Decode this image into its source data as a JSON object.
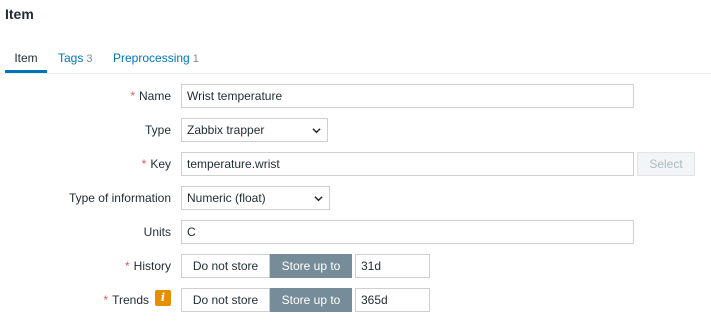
{
  "page": {
    "title": "Item"
  },
  "tabs": [
    {
      "label": "Item",
      "count": ""
    },
    {
      "label": "Tags",
      "count": "3"
    },
    {
      "label": "Preprocessing",
      "count": "1"
    }
  ],
  "form": {
    "name": {
      "label": "Name",
      "value": "Wrist temperature"
    },
    "type": {
      "label": "Type",
      "value": "Zabbix trapper"
    },
    "key": {
      "label": "Key",
      "value": "temperature.wrist",
      "select_label": "Select"
    },
    "type_of_information": {
      "label": "Type of information",
      "value": "Numeric (float)"
    },
    "units": {
      "label": "Units",
      "value": "C"
    },
    "history": {
      "label": "History",
      "option_off": "Do not store",
      "option_on": "Store up to",
      "value": "31d"
    },
    "trends": {
      "label": "Trends",
      "option_off": "Do not store",
      "option_on": "Store up to",
      "value": "365d",
      "info_icon": "i"
    }
  },
  "required_marker": "*",
  "colors": {
    "accent": "#0275b8",
    "required": "#e45959",
    "segment_active": "#768d99",
    "info": "#e68d00"
  }
}
